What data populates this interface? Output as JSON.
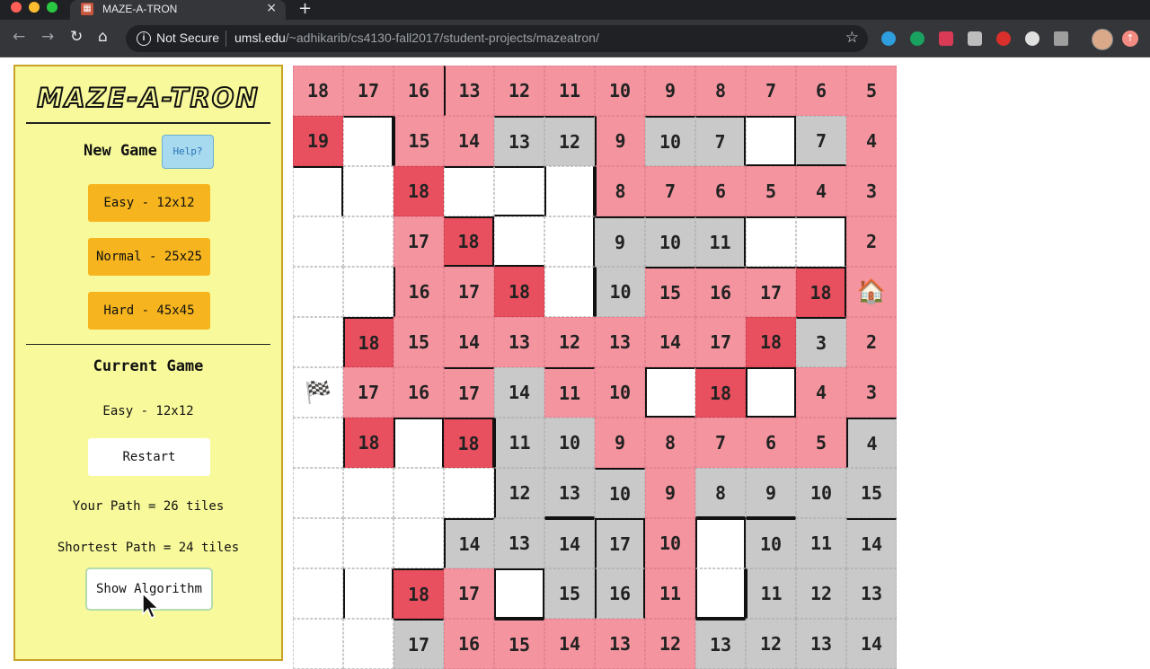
{
  "browser": {
    "tab_title": "MAZE-A-TRON",
    "tab_close": "×",
    "new_tab": "+",
    "security_label": "Not Secure",
    "url_host": "umsl.edu",
    "url_path": "/~adhikarib/cs4130-fall2017/student-projects/mazeatron/",
    "back": "←",
    "forward": "→",
    "reload": "↻",
    "home": "⌂",
    "bookmark": "☆"
  },
  "sidebar": {
    "logo": "MAZE-A-TRON",
    "new_game_label": "New Game",
    "help_label": "Help?",
    "difficulties": [
      "Easy - 12x12",
      "Normal - 25x25",
      "Hard - 45x45"
    ],
    "current_game_label": "Current Game",
    "current_difficulty": "Easy - 12x12",
    "restart_label": "Restart",
    "your_path": "Your Path = 26 tiles",
    "shortest_path": "Shortest Path = 24 tiles",
    "show_algorithm_label": "Show Algorithm"
  },
  "colors": {
    "pink": "#f4949f",
    "red": "#e9505f",
    "gray": "#c9c9c9",
    "sidebar_bg": "#f8f99a",
    "button_orange": "#f6b51e"
  },
  "maze": {
    "icons": {
      "start": "checkered-flag-icon",
      "goal": "house-icon"
    },
    "rows": [
      [
        "18",
        "17",
        "16",
        "13",
        "12",
        "11",
        "10",
        "9",
        "8",
        "7",
        "6",
        "5"
      ],
      [
        "19",
        "",
        "15",
        "14",
        "13",
        "12",
        "9",
        "10",
        "7",
        "",
        "7",
        "4"
      ],
      [
        "",
        "",
        "18",
        "",
        "",
        "",
        "8",
        "7",
        "6",
        "5",
        "4",
        "3"
      ],
      [
        "",
        "",
        "17",
        "18",
        "",
        "",
        "9",
        "10",
        "11",
        "",
        "",
        "2"
      ],
      [
        "",
        "",
        "16",
        "17",
        "18",
        "",
        "10",
        "15",
        "16",
        "17",
        "18",
        "🏠"
      ],
      [
        "",
        "18",
        "15",
        "14",
        "13",
        "12",
        "13",
        "14",
        "17",
        "18",
        "3",
        "2"
      ],
      [
        "🏁",
        "17",
        "16",
        "17",
        "14",
        "11",
        "10",
        "",
        "18",
        "",
        "4",
        "3"
      ],
      [
        "",
        "18",
        "",
        "18",
        "11",
        "10",
        "9",
        "8",
        "7",
        "6",
        "5",
        "4"
      ],
      [
        "",
        "",
        "",
        "",
        "12",
        "13",
        "10",
        "9",
        "8",
        "9",
        "10",
        "15"
      ],
      [
        "",
        "",
        "",
        "14",
        "13",
        "14",
        "17",
        "10",
        "",
        "10",
        "11",
        "14"
      ],
      [
        "",
        "",
        "18",
        "17",
        "",
        "15",
        "16",
        "11",
        "",
        "11",
        "12",
        "13"
      ],
      [
        "",
        "",
        "17",
        "16",
        "15",
        "14",
        "13",
        "12",
        "13",
        "12",
        "13",
        "14"
      ]
    ],
    "colors": [
      [
        "p",
        "p",
        "p",
        "p",
        "p",
        "p",
        "p",
        "p",
        "p",
        "p",
        "p",
        "p"
      ],
      [
        "r",
        "e",
        "p",
        "p",
        "g",
        "g",
        "p",
        "g",
        "g",
        "e",
        "g",
        "p"
      ],
      [
        "e",
        "e",
        "r",
        "e",
        "e",
        "e",
        "p",
        "p",
        "p",
        "p",
        "p",
        "p"
      ],
      [
        "e",
        "e",
        "p",
        "r",
        "e",
        "e",
        "g",
        "g",
        "g",
        "e",
        "e",
        "p"
      ],
      [
        "e",
        "e",
        "p",
        "p",
        "r",
        "e",
        "g",
        "p",
        "p",
        "p",
        "r",
        "h"
      ],
      [
        "e",
        "r",
        "p",
        "p",
        "p",
        "p",
        "p",
        "p",
        "p",
        "r",
        "g",
        "p"
      ],
      [
        "s",
        "p",
        "p",
        "p",
        "g",
        "p",
        "p",
        "e",
        "r",
        "e",
        "p",
        "p"
      ],
      [
        "e",
        "r",
        "e",
        "r",
        "g",
        "g",
        "p",
        "p",
        "p",
        "p",
        "p",
        "g"
      ],
      [
        "e",
        "e",
        "e",
        "e",
        "g",
        "g",
        "g",
        "p",
        "g",
        "g",
        "g",
        "g"
      ],
      [
        "e",
        "e",
        "e",
        "g",
        "g",
        "g",
        "g",
        "p",
        "e",
        "g",
        "g",
        "g"
      ],
      [
        "e",
        "e",
        "r",
        "p",
        "e",
        "g",
        "g",
        "p",
        "e",
        "g",
        "g",
        "g"
      ],
      [
        "e",
        "e",
        "g",
        "p",
        "p",
        "p",
        "p",
        "p",
        "g",
        "g",
        "g",
        "g"
      ]
    ]
  }
}
